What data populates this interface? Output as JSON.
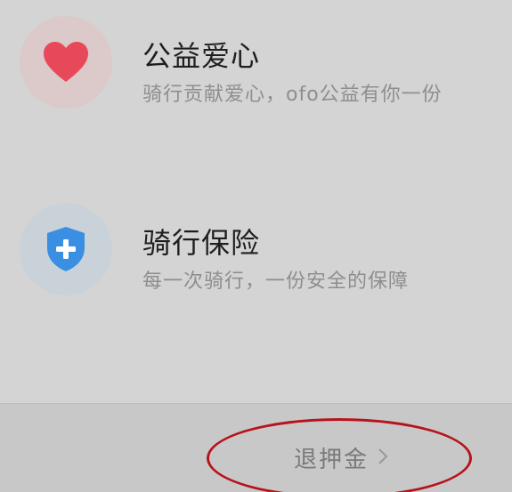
{
  "features": [
    {
      "title": "公益爱心",
      "subtitle": "骑行贡献爱心，ofo公益有你一份",
      "icon": "heart-icon"
    },
    {
      "title": "骑行保险",
      "subtitle": "每一次骑行，一份安全的保障",
      "icon": "shield-plus-icon"
    }
  ],
  "footer": {
    "refund_label": "退押金",
    "chevron_icon": "chevron-right-icon"
  },
  "annotation": {
    "color": "#b5141a"
  },
  "colors": {
    "heart": "#e8495a",
    "shield": "#3a8fe2",
    "background": "#d4d4d4"
  }
}
